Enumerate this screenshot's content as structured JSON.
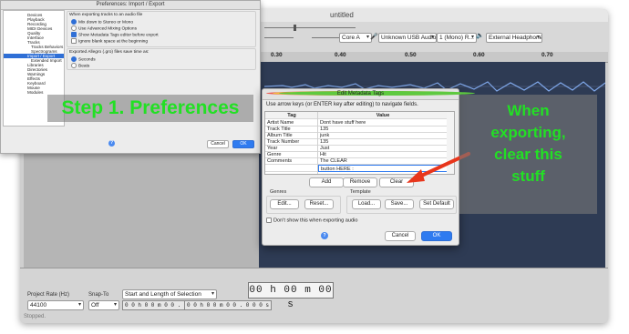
{
  "audacity": {
    "title": "untitled",
    "devices": {
      "host": "Core A",
      "input": "Unknown USB Audio...",
      "channels": "1 (Mono) R...",
      "output": "External Headphones"
    },
    "ruler_ticks": [
      "0.30",
      "0.40",
      "0.50",
      "0.60",
      "0.70"
    ],
    "bottom": {
      "project_rate_label": "Project Rate (Hz)",
      "project_rate_value": "44100",
      "snap_to_label": "Snap-To",
      "snap_to_value": "Off",
      "selection_mode": "Start and Length of Selection",
      "sel_start": "0 0 h 0 0 m 0 0 . 0 0 0 s",
      "sel_length": "0 0 h 0 0 m 0 0 . 0 0 0 s",
      "big_time": "00 h 00 m 00 s",
      "status": "Stopped."
    }
  },
  "preferences": {
    "title": "Preferences: Import / Export",
    "tree": [
      "Devices",
      "Playback",
      "Recording",
      "MIDI Devices",
      "Quality",
      "Interface",
      "Tracks",
      "Tracks Behaviors",
      "Spectrograms",
      "Import / Export",
      "Extended Import",
      "Libraries",
      "Directories",
      "Warnings",
      "Effects",
      "Keyboard",
      "Mouse",
      "Modules"
    ],
    "section_heading": "When exporting tracks to an audio file",
    "options": [
      {
        "label": "Mix down to Stereo or Mono",
        "checked": true,
        "kind": "radio"
      },
      {
        "label": "Use Advanced Mixing Options",
        "checked": false,
        "kind": "radio"
      },
      {
        "label": "Show Metadata Tags editor before export",
        "checked": true,
        "kind": "check"
      },
      {
        "label": "Ignore blank space at the beginning",
        "checked": false,
        "kind": "check"
      }
    ],
    "allegro_heading": "Exported Allegro (.gro) files save time as:",
    "allegro_options": [
      {
        "label": "Seconds",
        "checked": true
      },
      {
        "label": "Beats",
        "checked": false
      }
    ],
    "cancel": "Cancel",
    "ok": "OK",
    "help": "?"
  },
  "step1_label": "Step 1. Preferences",
  "metadata": {
    "title": "Edit Metadata Tags",
    "instruction": "Use arrow keys (or ENTER key after editing) to navigate fields.",
    "col_tag": "Tag",
    "col_value": "Value",
    "rows": [
      {
        "tag": "Artist Name",
        "value": "Dont have stuff here"
      },
      {
        "tag": "Track Title",
        "value": "135"
      },
      {
        "tag": "Album Title",
        "value": "junk"
      },
      {
        "tag": "Track Number",
        "value": "135"
      },
      {
        "tag": "Year",
        "value": "Just"
      },
      {
        "tag": "Genre",
        "value": "Hit"
      },
      {
        "tag": "Comments",
        "value": "The CLEAR"
      },
      {
        "tag": "",
        "value": "button HERE :"
      }
    ],
    "add": "Add",
    "remove": "Remove",
    "clear": "Clear",
    "genres_label": "Genres",
    "edit": "Edit...",
    "reset": "Reset...",
    "template_label": "Template",
    "load": "Load...",
    "save": "Save...",
    "set_default": "Set Default",
    "dont_show": "Don't show this when exporting audio",
    "cancel": "Cancel",
    "ok": "OK",
    "help": "?"
  },
  "annotation": {
    "line1": "When",
    "line2": "exporting,",
    "line3": "clear this",
    "line4": "stuff"
  },
  "colors": {
    "overlay_green": "#22e024",
    "arrow_red": "#e8361c",
    "accent_blue": "#2f7bf0"
  }
}
